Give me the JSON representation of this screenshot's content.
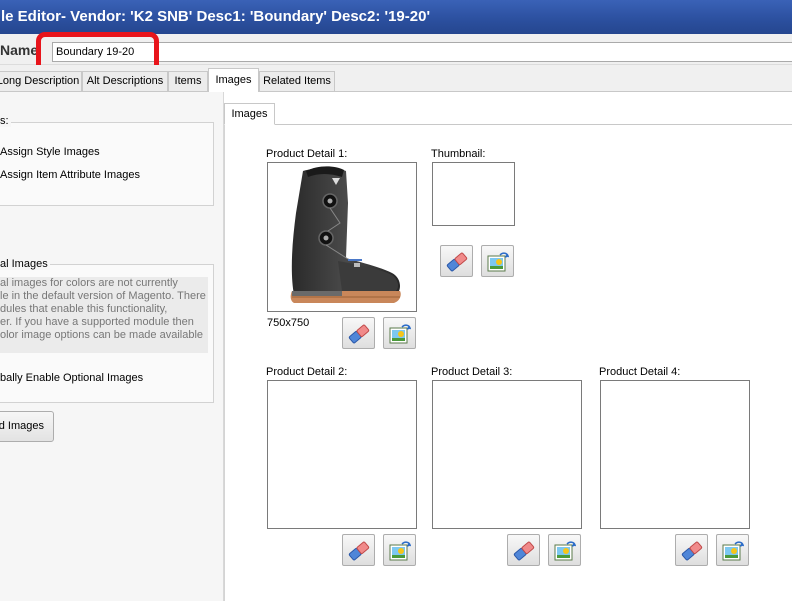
{
  "window": {
    "title": "le Editor- Vendor: 'K2 SNB' Desc1: 'Boundary' Desc2: '19-20'"
  },
  "name_row": {
    "label": "Name",
    "value": "Boundary 19-20"
  },
  "tabs": [
    {
      "label": "Long Description"
    },
    {
      "label": "Alt Descriptions"
    },
    {
      "label": "Items"
    },
    {
      "label": "Images",
      "active": true
    },
    {
      "label": "Related Items"
    }
  ],
  "left": {
    "group1_title": "s:",
    "options": [
      "Assign Style Images",
      "Assign Item Attribute Images"
    ],
    "group2_title": "al Images",
    "notice_lines": [
      "al images for colors are not currently",
      "le in the default version of Magento. There",
      "dules that enable this functionality,",
      "er. If you have a supported module then",
      "olor image options can be made available"
    ],
    "enable_label": "bally Enable Optional Images",
    "add_button": "d Images"
  },
  "images_tab": {
    "inner_tab_label": "Images",
    "slots": [
      {
        "label": "Product Detail 1:",
        "size": "750x750",
        "has_image": true
      },
      {
        "label": "Thumbnail:"
      },
      {
        "label": "Product Detail 2:"
      },
      {
        "label": "Product Detail 3:"
      },
      {
        "label": "Product Detail 4:"
      }
    ]
  },
  "icons": {
    "clear": "eraser-icon",
    "load": "load-image-icon"
  },
  "colors": {
    "title_bar": "#2f57a8",
    "highlight": "#e8141b"
  }
}
